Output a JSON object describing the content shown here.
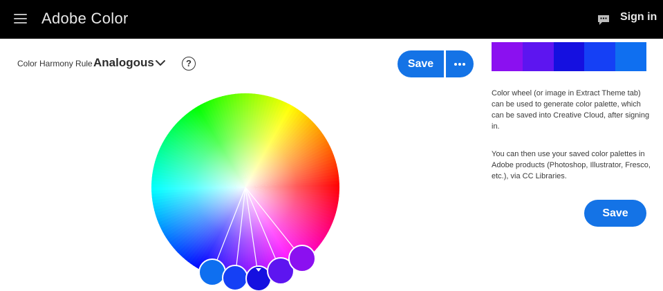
{
  "header": {
    "app_title": "Adobe Color",
    "menu_icon": "hamburger-menu-icon",
    "chat_icon": "chat-icon",
    "sign_in": "Sign in"
  },
  "harmony": {
    "label": "Color Harmony Rule",
    "value": "Analogous",
    "help": "?"
  },
  "actions": {
    "save_label": "Save",
    "more_icon": "more-dots-icon",
    "side_save_label": "Save"
  },
  "palette": {
    "colors": [
      "#8b10f0",
      "#5d15f0",
      "#1510e0",
      "#1540f5",
      "#0f6ff0"
    ]
  },
  "info": {
    "paragraph1": "Color wheel (or image in Extract Theme tab) can be used to generate color palette, which can be saved into Creative Cloud, after signing in.",
    "paragraph2": "You can then use your saved color palettes in Adobe products (Photoshop, Illustrator, Fresco, etc.), via CC Libraries."
  },
  "wheel": {
    "handle_colors": [
      "#0e6ff0",
      "#1540f5",
      "#1510e0",
      "#5d15f0",
      "#8b10f0"
    ],
    "base_handle_index": 2
  }
}
